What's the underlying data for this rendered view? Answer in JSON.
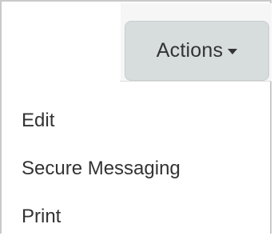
{
  "actions_button": {
    "label": "Actions",
    "icon": "caret-down-icon"
  },
  "menu": {
    "items": [
      {
        "label": "Edit"
      },
      {
        "label": "Secure Messaging"
      },
      {
        "label": "Print"
      }
    ]
  },
  "colors": {
    "button_bg": "#d7dcdd",
    "text": "#333333",
    "frame_border": "#c9c9c9"
  }
}
